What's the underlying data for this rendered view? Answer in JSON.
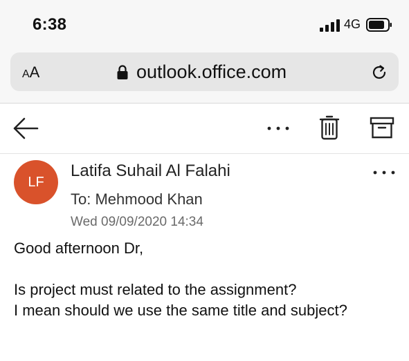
{
  "status_bar": {
    "time": "6:38",
    "network": "4G"
  },
  "browser": {
    "text_size_label_small": "A",
    "text_size_label_large": "A",
    "url": "outlook.office.com"
  },
  "email": {
    "avatar_initials": "LF",
    "avatar_color": "#d9522b",
    "sender": "Latifa Suhail Al Falahi",
    "to_line": "To: Mehmood Khan",
    "date": "Wed 09/09/2020 14:34",
    "body": [
      "Good afternoon Dr,",
      "",
      "Is project must related to the assignment?",
      "I mean should we use the same title and subject?"
    ]
  }
}
